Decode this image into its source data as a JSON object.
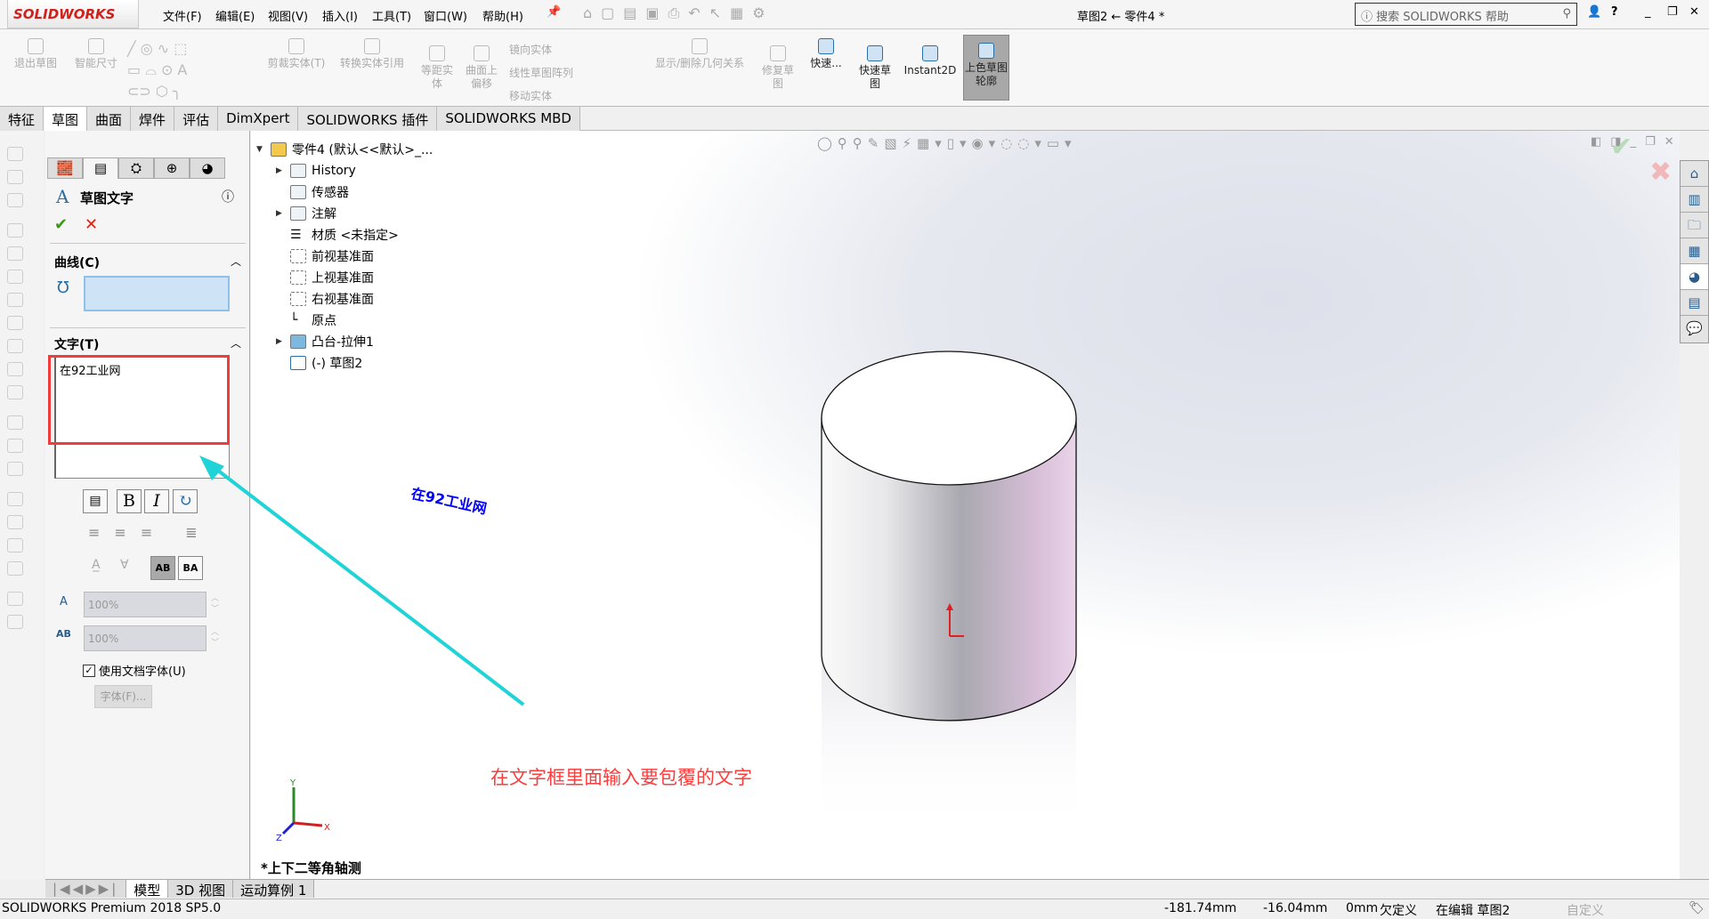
{
  "app": {
    "logo": "SOLIDWORKS",
    "title": "草图2 ← 零件4 *",
    "search_placeholder": "搜索 SOLIDWORKS 帮助"
  },
  "menu": [
    "文件(F)",
    "编辑(E)",
    "视图(V)",
    "插入(I)",
    "工具(T)",
    "窗口(W)",
    "帮助(H)"
  ],
  "ribbon": {
    "exit_sketch": "退出草图",
    "smart_dim": "智能尺寸",
    "trim": "剪裁实体(T)",
    "convert": "转换实体引用",
    "offset": "等距实体",
    "surface_offset": "曲面上偏移",
    "mirror": "镜向实体",
    "linear_pattern": "线性草图阵列",
    "move": "移动实体",
    "relations": "显示/删除几何关系",
    "repair": "修复草图",
    "quick_snaps": "快速...",
    "rapid_sketch": "快速草图",
    "instant2d": "Instant2D",
    "shaded_contours": "上色草图轮廓"
  },
  "tabs": [
    "特征",
    "草图",
    "曲面",
    "焊件",
    "评估",
    "DimXpert",
    "SOLIDWORKS 插件",
    "SOLIDWORKS MBD"
  ],
  "active_tab": "草图",
  "panel": {
    "title": "草图文字",
    "curves_label": "曲线(C)",
    "text_label": "文字(T)",
    "text_value": "在92工业网",
    "bold": "B",
    "italic": "I",
    "width_factor": "100%",
    "spacing": "100%",
    "use_doc_font": "使用文档字体(U)",
    "use_doc_font_checked": true,
    "font_button": "字体(F)..."
  },
  "tree": {
    "root": "零件4 (默认<<默认>_...",
    "items": [
      "History",
      "传感器",
      "注解",
      "材质 <未指定>",
      "前视基准面",
      "上视基准面",
      "右视基准面",
      "原点",
      "凸台-拉伸1",
      "(-) 草图2"
    ]
  },
  "viewport": {
    "sketch_text": "在92工业网",
    "annotation": "在文字框里面输入要包覆的文字",
    "view_label": "*上下二等角轴测",
    "annotation_color": "#ff3b3b",
    "arrow_color": "#1fd3d6",
    "sketch_text_color": "#0000ff"
  },
  "bottom_tabs": [
    "模型",
    "3D 视图",
    "运动算例 1"
  ],
  "status": {
    "product": "SOLIDWORKS Premium 2018 SP5.0",
    "x": "-181.74mm",
    "y": "-16.04mm",
    "z": "0mm",
    "state": "欠定义",
    "mode": "在编辑 草图2",
    "custom": "自定义"
  }
}
